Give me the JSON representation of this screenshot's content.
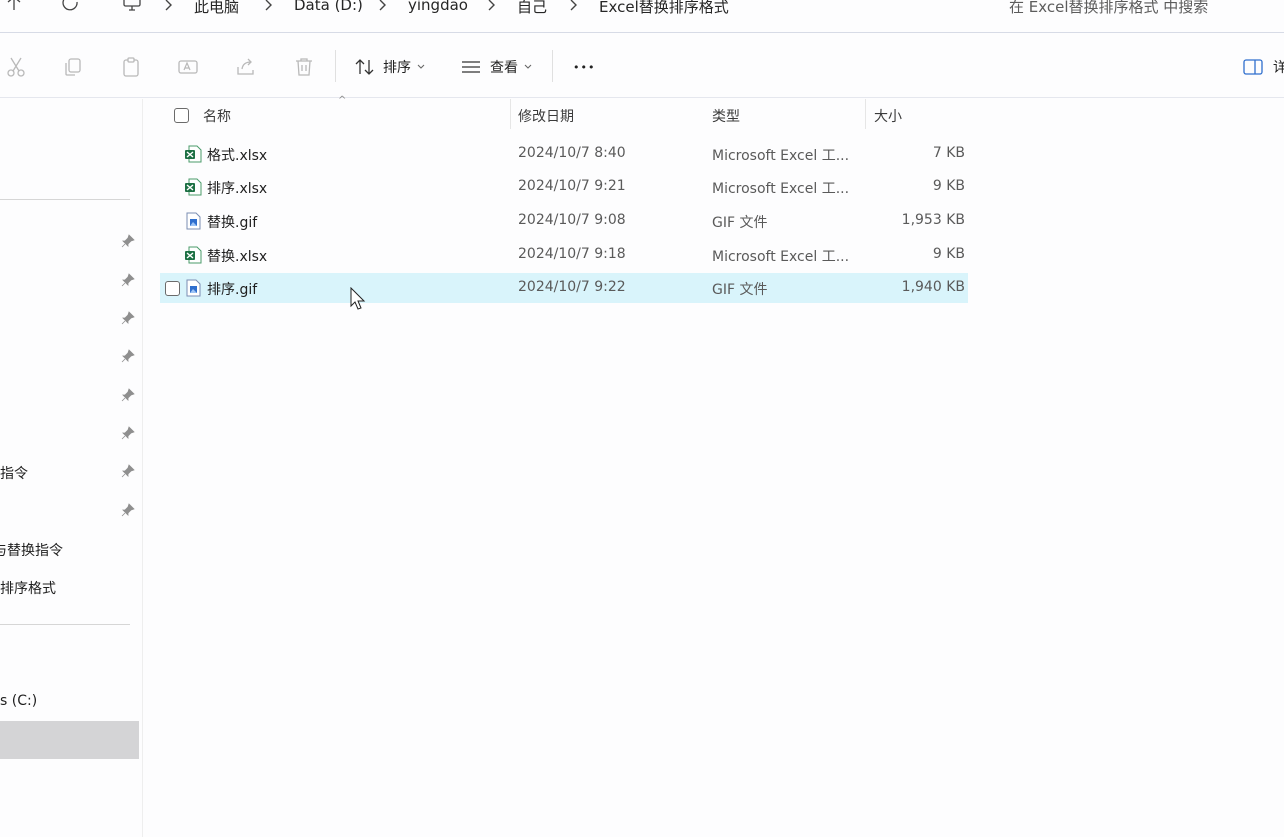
{
  "address": {
    "crumbs": [
      "此电脑",
      "Data (D:)",
      "yingdao",
      "自己",
      "Excel替换排序格式"
    ],
    "search_placeholder": "在 Excel替换排序格式 中搜索"
  },
  "toolbar": {
    "sort_label": "排序",
    "view_label": "查看",
    "more_label": "•••",
    "details_label": "详"
  },
  "sidebar": {
    "texts": [
      "指令",
      "与替换指令",
      "排序格式",
      "s (C:)"
    ]
  },
  "columns": {
    "name": "名称",
    "date": "修改日期",
    "type": "类型",
    "size": "大小"
  },
  "files": [
    {
      "name": "格式.xlsx",
      "date": "2024/10/7 8:40",
      "type": "Microsoft Excel 工...",
      "size": "7 KB",
      "kind": "excel-icon"
    },
    {
      "name": "排序.xlsx",
      "date": "2024/10/7 9:21",
      "type": "Microsoft Excel 工...",
      "size": "9 KB",
      "kind": "excel-icon"
    },
    {
      "name": "替换.gif",
      "date": "2024/10/7 9:08",
      "type": "GIF 文件",
      "size": "1,953 KB",
      "kind": "gif-icon"
    },
    {
      "name": "替换.xlsx",
      "date": "2024/10/7 9:18",
      "type": "Microsoft Excel 工...",
      "size": "9 KB",
      "kind": "excel-icon"
    },
    {
      "name": "排序.gif",
      "date": "2024/10/7 9:22",
      "type": "GIF 文件",
      "size": "1,940 KB",
      "kind": "gif-icon"
    }
  ],
  "colors": {
    "selected_row": "#d9f4fb",
    "excel_green": "#1d7044",
    "gif_blue": "#2f6fce"
  }
}
